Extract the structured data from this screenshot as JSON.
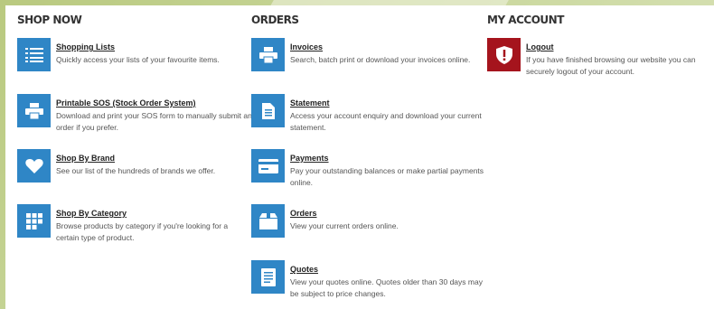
{
  "columns": {
    "shop": {
      "heading": "SHOP NOW",
      "items": [
        {
          "title": "Shopping Lists",
          "desc": "Quickly access your lists of your favourite items.",
          "icon": "list-icon"
        },
        {
          "title": "Printable SOS (Stock Order System)",
          "desc": "Download and print your SOS form to manually submit an order if you prefer.",
          "icon": "printer-icon"
        },
        {
          "title": "Shop By Brand",
          "desc": "See our list of the hundreds of brands we offer.",
          "icon": "heart-icon"
        },
        {
          "title": "Shop By Category",
          "desc": "Browse products by category if you're looking for a certain type of product.",
          "icon": "grid-icon"
        }
      ]
    },
    "orders": {
      "heading": "ORDERS",
      "items": [
        {
          "title": "Invoices",
          "desc": "Search, batch print or download your invoices online.",
          "icon": "printer-icon"
        },
        {
          "title": "Statement",
          "desc": "Access your account enquiry and download your current statement.",
          "icon": "document-icon"
        },
        {
          "title": "Payments",
          "desc": "Pay your outstanding balances or make partial payments online.",
          "icon": "credit-card-icon"
        },
        {
          "title": "Orders",
          "desc": "View your current orders online.",
          "icon": "box-icon"
        },
        {
          "title": "Quotes",
          "desc": "View your quotes online. Quotes older than 30 days may be subject to price changes.",
          "icon": "quote-document-icon"
        }
      ]
    },
    "account": {
      "heading": "MY ACCOUNT",
      "items": [
        {
          "title": "Logout",
          "desc": "If you have finished browsing our website you can securely logout of your account.",
          "icon": "shield-alert-icon"
        }
      ]
    }
  },
  "colors": {
    "icon_blue": "#2f86c6",
    "icon_red": "#a5141d",
    "frame_green": "#b9c97f"
  }
}
